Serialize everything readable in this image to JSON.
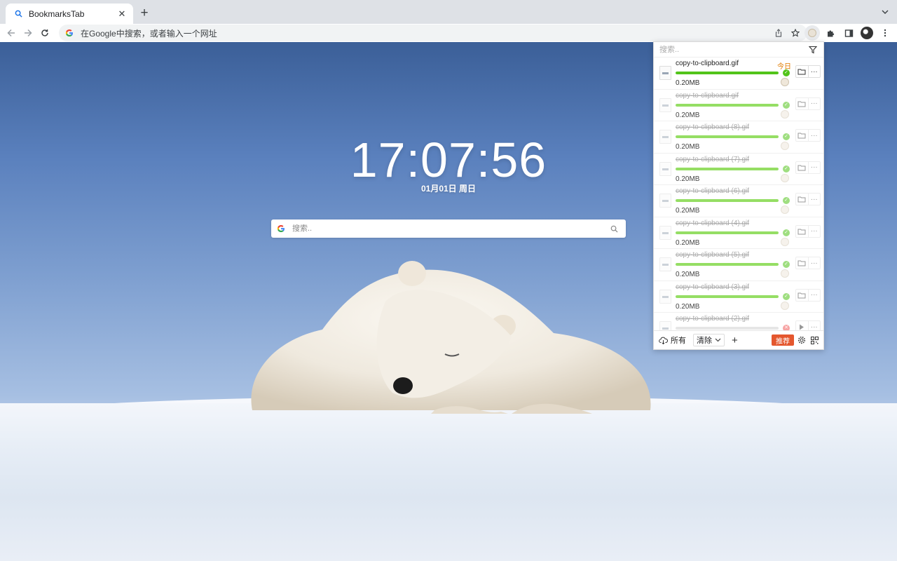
{
  "browser": {
    "tab_title": "BookmarksTab",
    "omnibox_placeholder": "在Google中搜索，或者输入一个网址"
  },
  "page": {
    "clock": "17:07:56",
    "date": "01月01日 周日",
    "search_placeholder": "搜索.."
  },
  "downloads": {
    "search_placeholder": "搜索..",
    "today_label": "今日",
    "items": [
      {
        "name": "copy-to-clipboard.gif",
        "size": "0.20MB",
        "progress": 1.0,
        "status": "complete",
        "faded": false
      },
      {
        "name": "copy-to-clipboard.gif",
        "size": "0.20MB",
        "progress": 1.0,
        "status": "complete",
        "faded": true
      },
      {
        "name": "copy-to-clipboard (8).gif",
        "size": "0.20MB",
        "progress": 1.0,
        "status": "complete",
        "faded": true
      },
      {
        "name": "copy-to-clipboard (7).gif",
        "size": "0.20MB",
        "progress": 1.0,
        "status": "complete",
        "faded": true
      },
      {
        "name": "copy-to-clipboard (6).gif",
        "size": "0.20MB",
        "progress": 1.0,
        "status": "complete",
        "faded": true
      },
      {
        "name": "copy-to-clipboard (4).gif",
        "size": "0.20MB",
        "progress": 1.0,
        "status": "complete",
        "faded": true
      },
      {
        "name": "copy-to-clipboard (5).gif",
        "size": "0.20MB",
        "progress": 1.0,
        "status": "complete",
        "faded": true
      },
      {
        "name": "copy-to-clipboard (3).gif",
        "size": "0.20MB",
        "progress": 1.0,
        "status": "complete",
        "faded": true
      },
      {
        "name": "copy-to-clipboard (2).gif",
        "size": "",
        "progress": 0.0,
        "status": "error",
        "faded": true
      }
    ],
    "footer": {
      "all_label": "所有",
      "clear_label": "清除",
      "recommend_label": "推荐"
    }
  },
  "colors": {
    "progress_green": "#52c41a",
    "today_orange": "#e07b00",
    "recommend_red": "#e4572e"
  }
}
